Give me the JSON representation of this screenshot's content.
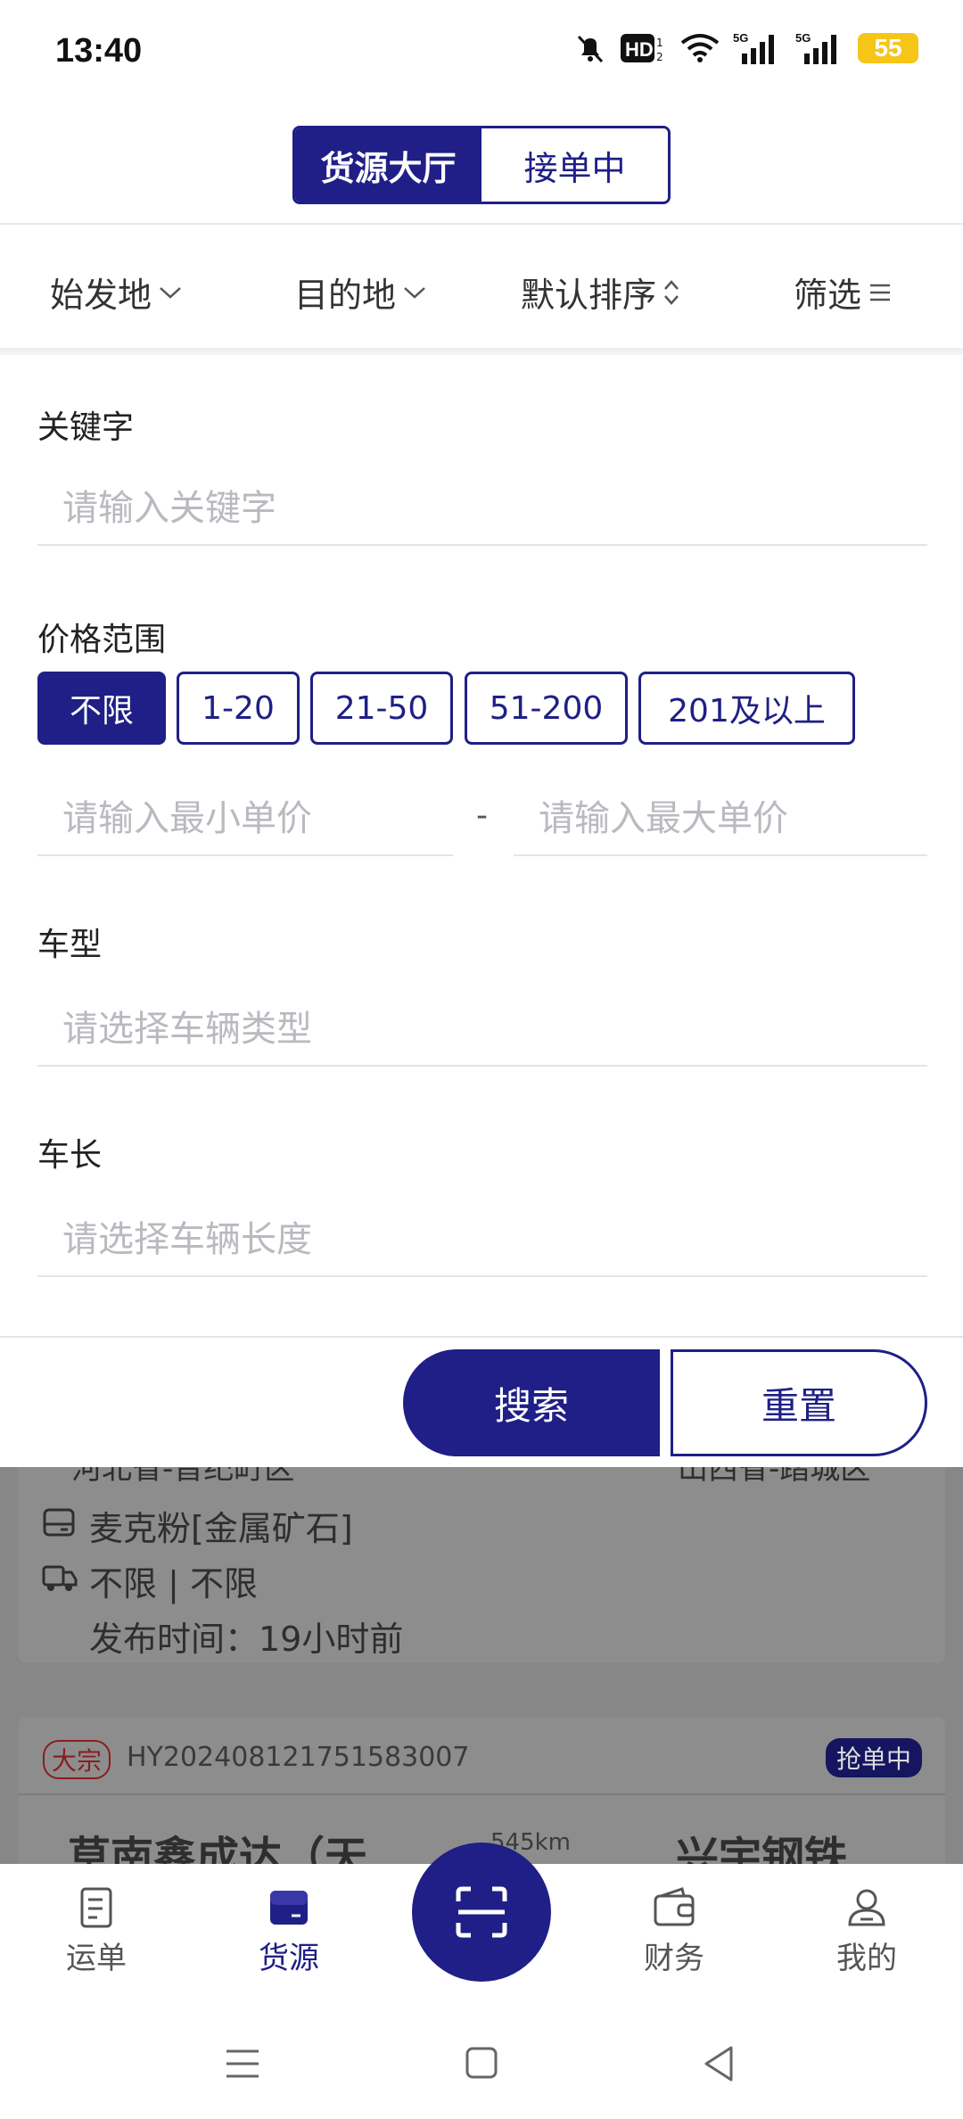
{
  "status_bar": {
    "time": "13:40",
    "battery": "55"
  },
  "tabs": [
    {
      "label": "货源大厅",
      "active": true
    },
    {
      "label": "接单中",
      "active": false
    }
  ],
  "filters": {
    "origin": "始发地",
    "destination": "目的地",
    "sort": "默认排序",
    "filter": "筛选"
  },
  "form": {
    "keyword_label": "关键字",
    "keyword_placeholder": "请输入关键字",
    "price_label": "价格范围",
    "price_options": [
      "不限",
      "1-20",
      "21-50",
      "51-200",
      "201及以上"
    ],
    "min_price_placeholder": "请输入最小单价",
    "range_separator": "-",
    "max_price_placeholder": "请输入最大单价",
    "vehicle_type_label": "车型",
    "vehicle_type_placeholder": "请选择车辆类型",
    "vehicle_length_label": "车长",
    "vehicle_length_placeholder": "请选择车辆长度",
    "search_button": "搜索",
    "reset_button": "重置"
  },
  "background_list": {
    "card1": {
      "origin_partial": "河北省-晋纪町区",
      "destination_partial": "山西省-踏城区",
      "cargo": "麦克粉[金属矿石]",
      "vehicle": "不限 | 不限",
      "published": "发布时间：19小时前"
    },
    "card2": {
      "tag": "大宗",
      "order_no": "HY20240812175158300­7",
      "status": "抢单中",
      "origin_partial": "草南鑫成达（天",
      "distance_partial": "545km",
      "destination_partial": "兴宇钢铁"
    }
  },
  "bottom_nav": [
    {
      "label": "运单",
      "icon": "waybill-icon",
      "active": false
    },
    {
      "label": "货源",
      "icon": "cargo-icon",
      "active": true
    },
    {
      "label": "财务",
      "icon": "wallet-icon",
      "active": false
    },
    {
      "label": "我的",
      "icon": "profile-icon",
      "active": false
    }
  ],
  "colors": {
    "primary": "#1f1f87",
    "placeholder": "#b9b9c0",
    "badge_red": "#8b1d1d"
  }
}
